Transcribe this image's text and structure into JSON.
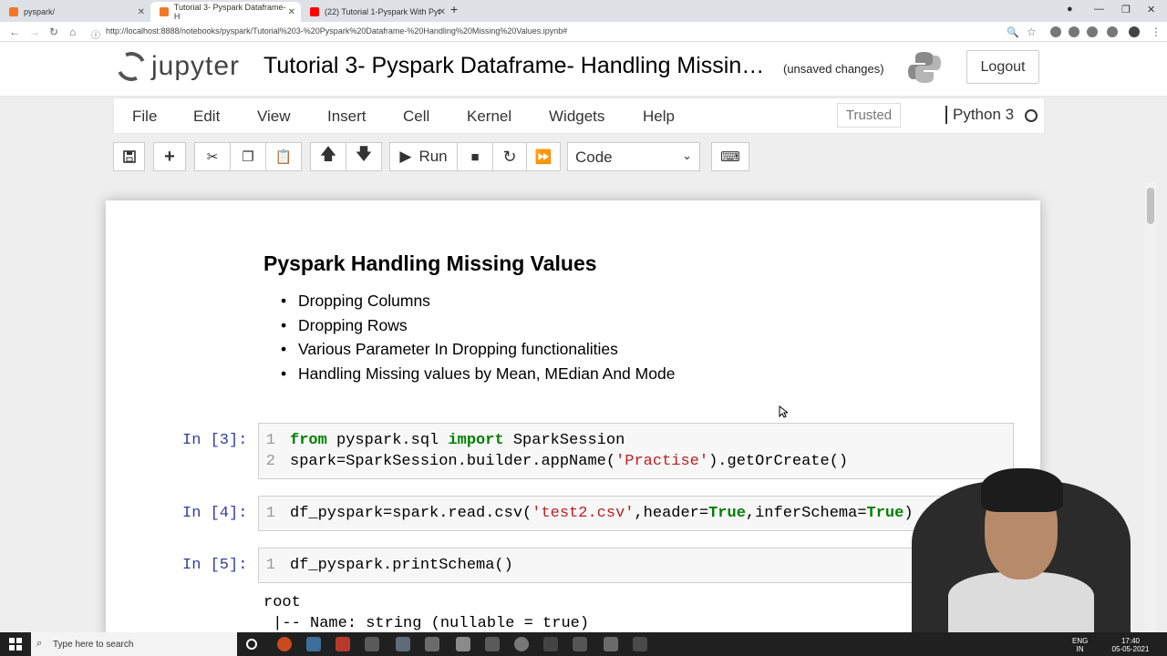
{
  "browser": {
    "tabs": [
      {
        "label": "pyspark/"
      },
      {
        "label": "Tutorial 3- Pyspark Dataframe- H"
      },
      {
        "label": "(22) Tutorial 1-Pyspark With Pyt"
      }
    ],
    "new_tab_label": "+",
    "url": "http://localhost:8888/notebooks/pyspark/Tutorial%203-%20Pyspark%20Dataframe-%20Handling%20Missing%20Values.ipynb#"
  },
  "header": {
    "logo_text": "jupyter",
    "notebook_title": "Tutorial 3- Pyspark Dataframe- Handling Missin…",
    "save_status": "(unsaved changes)",
    "logout_label": "Logout"
  },
  "menubar": {
    "items": [
      "File",
      "Edit",
      "View",
      "Insert",
      "Cell",
      "Kernel",
      "Widgets",
      "Help"
    ],
    "trusted_label": "Trusted",
    "kernel_name": "Python 3"
  },
  "toolbar": {
    "run_label": "Run",
    "cell_type": "Code"
  },
  "markdown": {
    "title": "Pyspark Handling Missing Values",
    "bullets": [
      "Dropping Columns",
      "Dropping Rows",
      "Various Parameter In Dropping functionalities",
      "Handling Missing values by Mean, MEdian And Mode"
    ]
  },
  "cells": [
    {
      "prompt": "In [3]:",
      "line_numbers": [
        "1",
        "2"
      ],
      "line1": {
        "kw1": "from",
        "mid": " pyspark.sql ",
        "kw2": "import",
        "rest": " SparkSession"
      },
      "line2": {
        "pre": "spark=SparkSession.builder.appName(",
        "str": "'Practise'",
        "post": ").getOrCreate()"
      }
    },
    {
      "prompt": "In [4]:",
      "line_numbers": [
        "1"
      ],
      "line1": {
        "pre": "df_pyspark=spark.read.csv(",
        "str": "'test2.csv'",
        "mid1": ",header=",
        "bool1": "True",
        "mid2": ",inferSchema=",
        "bool2": "True",
        "post": ")"
      }
    },
    {
      "prompt": "In [5]:",
      "line_numbers": [
        "1"
      ],
      "line1": "df_pyspark.printSchema()"
    }
  ],
  "output": {
    "line1": "root",
    "line2": " |-- Name: string (nullable = true)"
  },
  "taskbar": {
    "search_placeholder": "Type here to search",
    "lang_top": "ENG",
    "lang_bottom": "IN",
    "time": "17:40",
    "date": "05-05-2021"
  },
  "colors": {
    "prompt": "#303f9f",
    "keyword": "#008000",
    "string": "#ba2121"
  }
}
